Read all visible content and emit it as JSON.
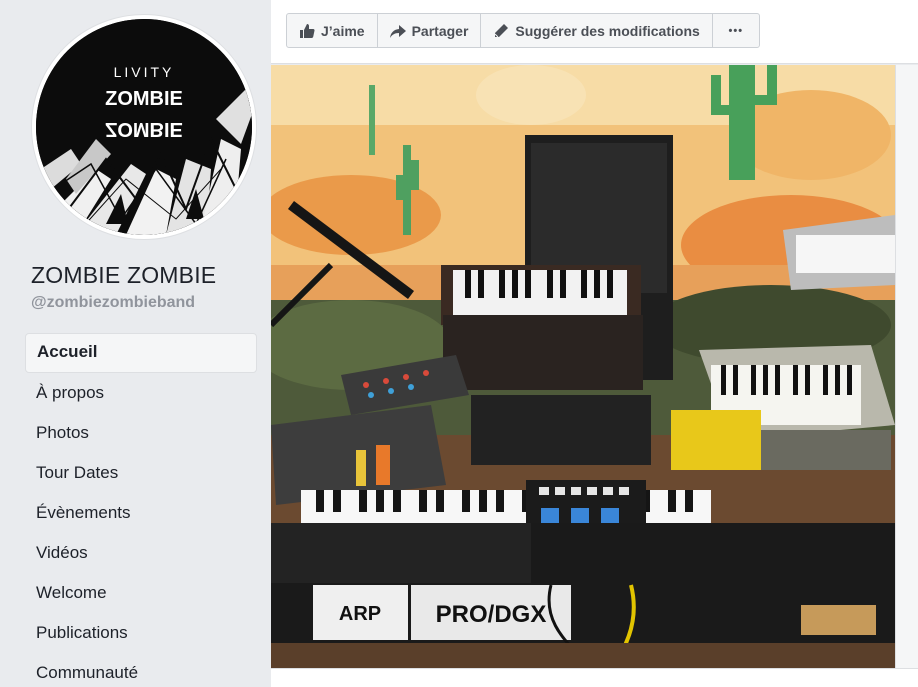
{
  "page": {
    "name": "ZOMBIE ZOMBIE",
    "handle": "@zombiezombieband"
  },
  "profile_picture": {
    "top_text": "LIVITY",
    "logo_text_1": "ZOMBIE",
    "logo_text_2": "ZOMBIE"
  },
  "nav": {
    "items": [
      {
        "label": "Accueil",
        "active": true
      },
      {
        "label": "À propos"
      },
      {
        "label": "Photos"
      },
      {
        "label": "Tour Dates"
      },
      {
        "label": "Évènements"
      },
      {
        "label": "Vidéos"
      },
      {
        "label": "Welcome"
      },
      {
        "label": "Publications"
      },
      {
        "label": "Communauté"
      }
    ]
  },
  "actions": {
    "like_label": "J’aime",
    "share_label": "Partager",
    "suggest_label": "Suggérer des modifications",
    "more_label": "•••",
    "icons": [
      "thumbs-up-icon",
      "share-arrow-icon",
      "pencil-icon",
      "more-icon"
    ]
  },
  "cover": {
    "arp_logo": "ARP",
    "model_text": "PRO/DGX"
  },
  "colors": {
    "background": "#e9ebee",
    "text": "#1d2129",
    "muted": "#90949c",
    "button_text": "#4b4f56"
  }
}
